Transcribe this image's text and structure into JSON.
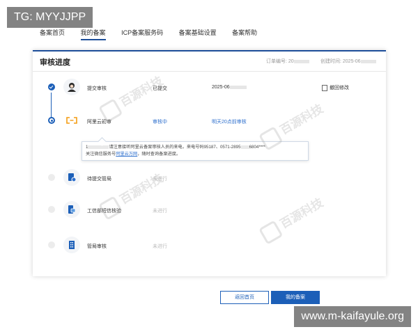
{
  "overlay": {
    "top_label": "TG: MYYJJPP",
    "bottom_label": "www.m-kaifayule.org"
  },
  "nav": [
    "备案首页",
    "我的备案",
    "ICP备案服务码",
    "备案基础设置",
    "备案帮助"
  ],
  "card": {
    "title": "审核进度",
    "order_label": "订单编号: 20",
    "created_label": "创建时间: 2025-06"
  },
  "steps": [
    {
      "label": "提交审核",
      "status": "已提交",
      "info": "2025-06",
      "action": "撤回修改"
    },
    {
      "label": "阿里云初审",
      "status": "审核中",
      "info": "明天20点前审核"
    },
    {
      "label": "待提交管局",
      "status": "未进行"
    },
    {
      "label": "工信部短信核验",
      "status": "未进行"
    },
    {
      "label": "管局审核",
      "status": "未进行"
    }
  ],
  "tip": {
    "line1_prefix": "1",
    "line1_text": "请注意接听阿里云备案审核人员的来电，来电号码95187、0571-2895",
    "line1_tail": "6804",
    "line2_prefix": "关注微信服务号",
    "line2_link": "阿里云万网",
    "line2_suffix": "，随时查询备案进度。"
  },
  "buttons": {
    "back": "返回首页",
    "mine": "我的备案"
  },
  "watermark": {
    "text": "百源科技"
  },
  "colors": {
    "primary": "#1c5fb8",
    "link": "#2d6fcd",
    "muted": "#bbbbbb"
  }
}
